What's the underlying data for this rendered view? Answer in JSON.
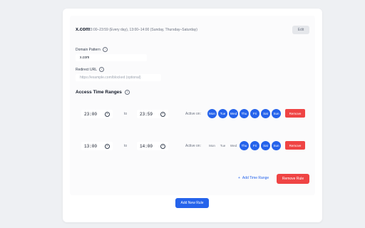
{
  "rule": {
    "domain_title": "x.com",
    "summary": "23:00–23:59 (Every day), 13:00–14:00 (Sunday, Thursday–Saturday)",
    "edit_label": "Edit",
    "domain_pattern_label": "Domain Pattern",
    "domain_pattern_value": "x.com",
    "redirect_label": "Redirect URL",
    "redirect_placeholder": "https://example.com/blocked (optional)",
    "access_title": "Access Time Ranges",
    "ranges": [
      {
        "start": "23:00",
        "end": "23:59",
        "to_label": "to",
        "active_label": "Active on:",
        "days": [
          {
            "label": "Mon",
            "active": true
          },
          {
            "label": "Tue",
            "active": true
          },
          {
            "label": "Wed",
            "active": true
          },
          {
            "label": "Thu",
            "active": true
          },
          {
            "label": "Fri",
            "active": true
          },
          {
            "label": "Sat",
            "active": true
          },
          {
            "label": "Sun",
            "active": true
          }
        ],
        "remove_label": "Remove"
      },
      {
        "start": "13:00",
        "end": "14:00",
        "to_label": "to",
        "active_label": "Active on:",
        "days": [
          {
            "label": "Mon",
            "active": false
          },
          {
            "label": "Tue",
            "active": false
          },
          {
            "label": "Wed",
            "active": false
          },
          {
            "label": "Thu",
            "active": true
          },
          {
            "label": "Fri",
            "active": true
          },
          {
            "label": "Sat",
            "active": true
          },
          {
            "label": "Sun",
            "active": true
          }
        ],
        "remove_label": "Remove"
      }
    ],
    "add_range_label": "Add Time Range",
    "remove_rule_label": "Remove Rule"
  },
  "add_rule_label": "Add New Rule",
  "colors": {
    "primary": "#2563eb",
    "danger": "#ef4444",
    "background": "#eef0f3"
  },
  "icons": {
    "info": "info-circle-icon",
    "clock": "clock-icon",
    "add": "plus-icon"
  }
}
